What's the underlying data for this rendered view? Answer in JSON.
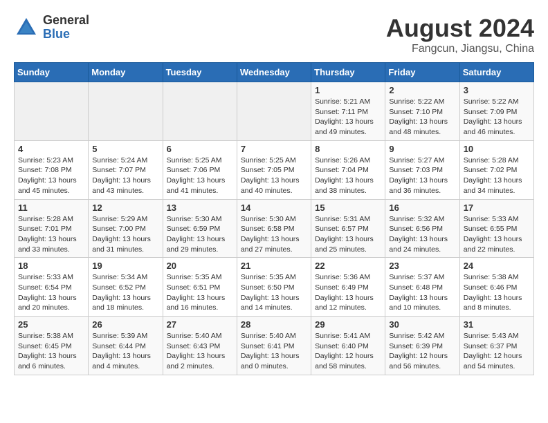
{
  "header": {
    "logo": {
      "general": "General",
      "blue": "Blue"
    },
    "title": "August 2024",
    "location": "Fangcun, Jiangsu, China"
  },
  "calendar": {
    "weekdays": [
      "Sunday",
      "Monday",
      "Tuesday",
      "Wednesday",
      "Thursday",
      "Friday",
      "Saturday"
    ],
    "weeks": [
      [
        {
          "day": "",
          "info": ""
        },
        {
          "day": "",
          "info": ""
        },
        {
          "day": "",
          "info": ""
        },
        {
          "day": "",
          "info": ""
        },
        {
          "day": "1",
          "info": "Sunrise: 5:21 AM\nSunset: 7:11 PM\nDaylight: 13 hours and 49 minutes."
        },
        {
          "day": "2",
          "info": "Sunrise: 5:22 AM\nSunset: 7:10 PM\nDaylight: 13 hours and 48 minutes."
        },
        {
          "day": "3",
          "info": "Sunrise: 5:22 AM\nSunset: 7:09 PM\nDaylight: 13 hours and 46 minutes."
        }
      ],
      [
        {
          "day": "4",
          "info": "Sunrise: 5:23 AM\nSunset: 7:08 PM\nDaylight: 13 hours and 45 minutes."
        },
        {
          "day": "5",
          "info": "Sunrise: 5:24 AM\nSunset: 7:07 PM\nDaylight: 13 hours and 43 minutes."
        },
        {
          "day": "6",
          "info": "Sunrise: 5:25 AM\nSunset: 7:06 PM\nDaylight: 13 hours and 41 minutes."
        },
        {
          "day": "7",
          "info": "Sunrise: 5:25 AM\nSunset: 7:05 PM\nDaylight: 13 hours and 40 minutes."
        },
        {
          "day": "8",
          "info": "Sunrise: 5:26 AM\nSunset: 7:04 PM\nDaylight: 13 hours and 38 minutes."
        },
        {
          "day": "9",
          "info": "Sunrise: 5:27 AM\nSunset: 7:03 PM\nDaylight: 13 hours and 36 minutes."
        },
        {
          "day": "10",
          "info": "Sunrise: 5:28 AM\nSunset: 7:02 PM\nDaylight: 13 hours and 34 minutes."
        }
      ],
      [
        {
          "day": "11",
          "info": "Sunrise: 5:28 AM\nSunset: 7:01 PM\nDaylight: 13 hours and 33 minutes."
        },
        {
          "day": "12",
          "info": "Sunrise: 5:29 AM\nSunset: 7:00 PM\nDaylight: 13 hours and 31 minutes."
        },
        {
          "day": "13",
          "info": "Sunrise: 5:30 AM\nSunset: 6:59 PM\nDaylight: 13 hours and 29 minutes."
        },
        {
          "day": "14",
          "info": "Sunrise: 5:30 AM\nSunset: 6:58 PM\nDaylight: 13 hours and 27 minutes."
        },
        {
          "day": "15",
          "info": "Sunrise: 5:31 AM\nSunset: 6:57 PM\nDaylight: 13 hours and 25 minutes."
        },
        {
          "day": "16",
          "info": "Sunrise: 5:32 AM\nSunset: 6:56 PM\nDaylight: 13 hours and 24 minutes."
        },
        {
          "day": "17",
          "info": "Sunrise: 5:33 AM\nSunset: 6:55 PM\nDaylight: 13 hours and 22 minutes."
        }
      ],
      [
        {
          "day": "18",
          "info": "Sunrise: 5:33 AM\nSunset: 6:54 PM\nDaylight: 13 hours and 20 minutes."
        },
        {
          "day": "19",
          "info": "Sunrise: 5:34 AM\nSunset: 6:52 PM\nDaylight: 13 hours and 18 minutes."
        },
        {
          "day": "20",
          "info": "Sunrise: 5:35 AM\nSunset: 6:51 PM\nDaylight: 13 hours and 16 minutes."
        },
        {
          "day": "21",
          "info": "Sunrise: 5:35 AM\nSunset: 6:50 PM\nDaylight: 13 hours and 14 minutes."
        },
        {
          "day": "22",
          "info": "Sunrise: 5:36 AM\nSunset: 6:49 PM\nDaylight: 13 hours and 12 minutes."
        },
        {
          "day": "23",
          "info": "Sunrise: 5:37 AM\nSunset: 6:48 PM\nDaylight: 13 hours and 10 minutes."
        },
        {
          "day": "24",
          "info": "Sunrise: 5:38 AM\nSunset: 6:46 PM\nDaylight: 13 hours and 8 minutes."
        }
      ],
      [
        {
          "day": "25",
          "info": "Sunrise: 5:38 AM\nSunset: 6:45 PM\nDaylight: 13 hours and 6 minutes."
        },
        {
          "day": "26",
          "info": "Sunrise: 5:39 AM\nSunset: 6:44 PM\nDaylight: 13 hours and 4 minutes."
        },
        {
          "day": "27",
          "info": "Sunrise: 5:40 AM\nSunset: 6:43 PM\nDaylight: 13 hours and 2 minutes."
        },
        {
          "day": "28",
          "info": "Sunrise: 5:40 AM\nSunset: 6:41 PM\nDaylight: 13 hours and 0 minutes."
        },
        {
          "day": "29",
          "info": "Sunrise: 5:41 AM\nSunset: 6:40 PM\nDaylight: 12 hours and 58 minutes."
        },
        {
          "day": "30",
          "info": "Sunrise: 5:42 AM\nSunset: 6:39 PM\nDaylight: 12 hours and 56 minutes."
        },
        {
          "day": "31",
          "info": "Sunrise: 5:43 AM\nSunset: 6:37 PM\nDaylight: 12 hours and 54 minutes."
        }
      ]
    ]
  }
}
